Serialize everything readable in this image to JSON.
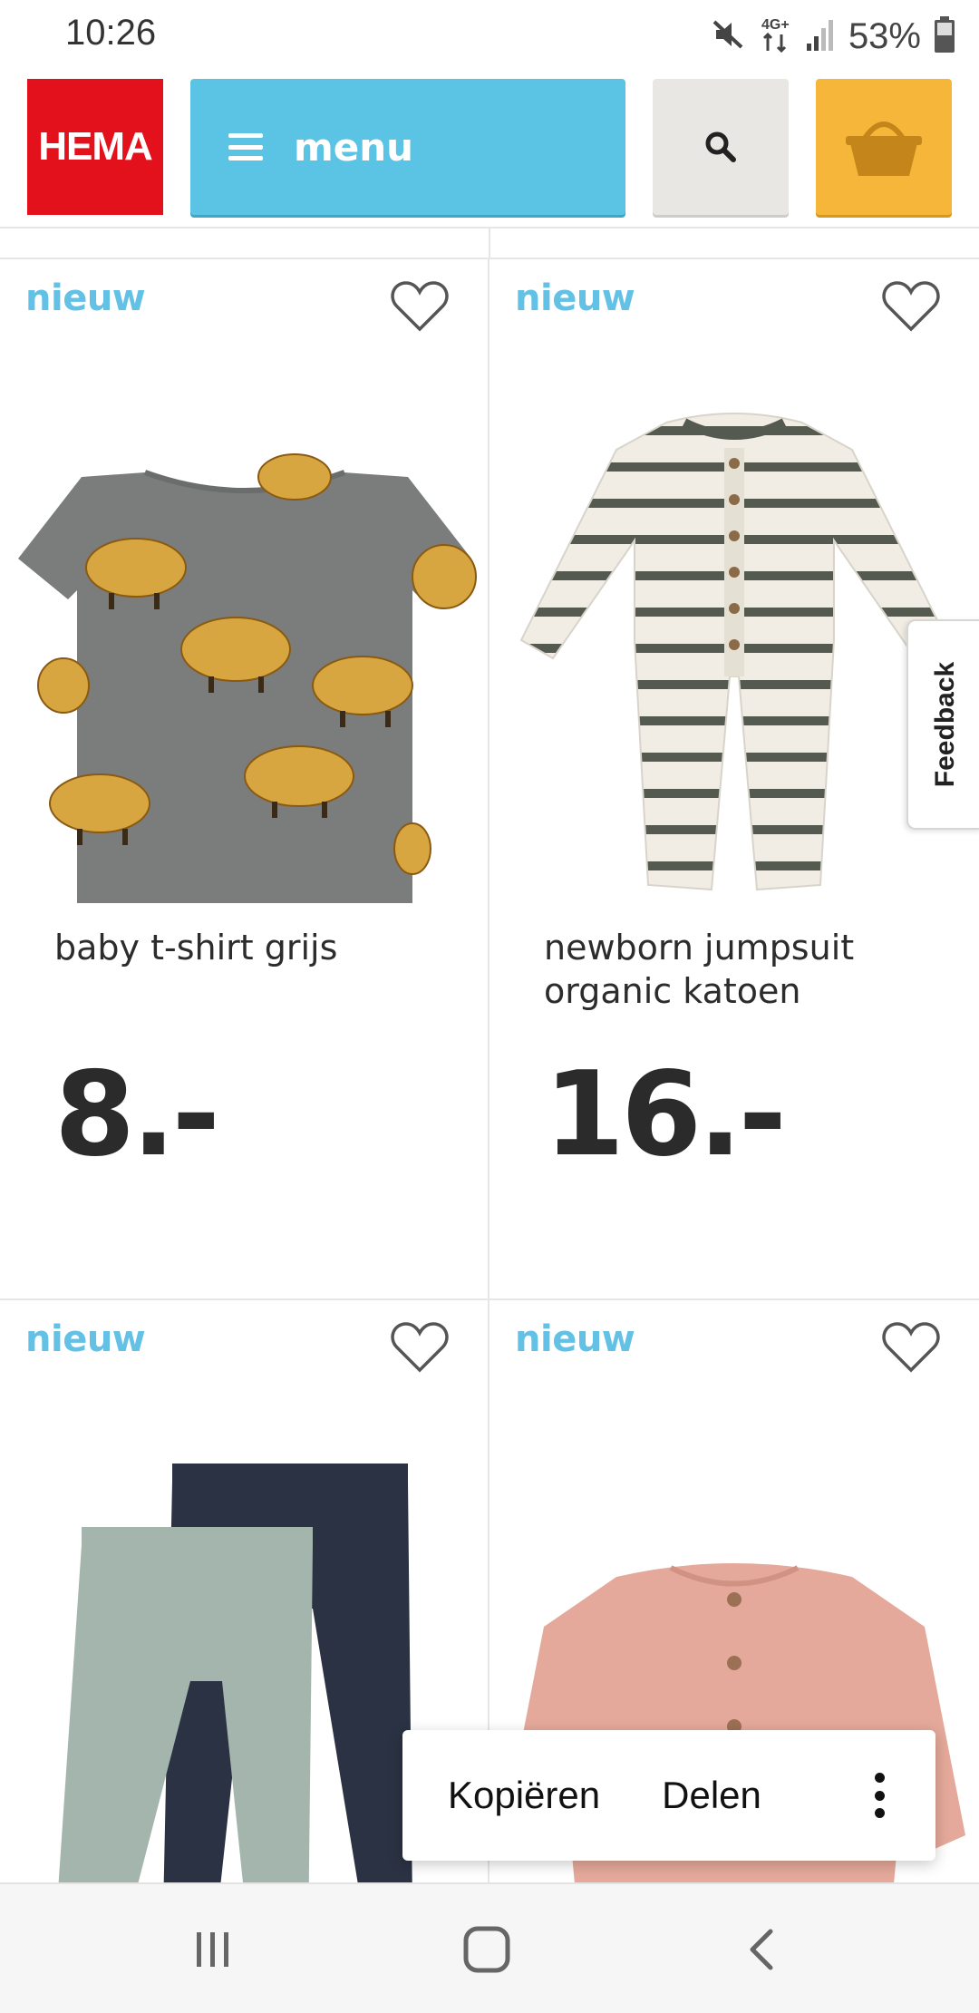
{
  "status_bar": {
    "time": "10:26",
    "network": "4G+",
    "battery": "53%",
    "icons": [
      "mute-icon",
      "network-4g-icon",
      "signal-icon",
      "battery-icon"
    ]
  },
  "header": {
    "logo_text": "HEMA",
    "menu_label": "menu",
    "colors": {
      "logo": "#e3111b",
      "menu": "#5bc4e4",
      "search": "#e8e7e3",
      "cart": "#f5b63a"
    }
  },
  "products": [
    {
      "badge": "nieuw",
      "title": "baby t-shirt grijs",
      "price": "8.-",
      "image": "grey-bison-tshirt"
    },
    {
      "badge": "nieuw",
      "title": "newborn jumpsuit organic katoen",
      "price": "16.-",
      "image": "striped-knit-jumpsuit"
    },
    {
      "badge": "nieuw",
      "title": "",
      "price": "",
      "image": "leggings-two-pack"
    },
    {
      "badge": "nieuw",
      "title": "",
      "price": "",
      "image": "pink-knit-cardigan"
    }
  ],
  "feedback": {
    "label": "Feedback"
  },
  "context_menu": {
    "copy": "Kopiëren",
    "share": "Delen"
  },
  "nav_bar": {
    "icons": [
      "recent-apps-icon",
      "home-icon",
      "back-icon"
    ]
  }
}
